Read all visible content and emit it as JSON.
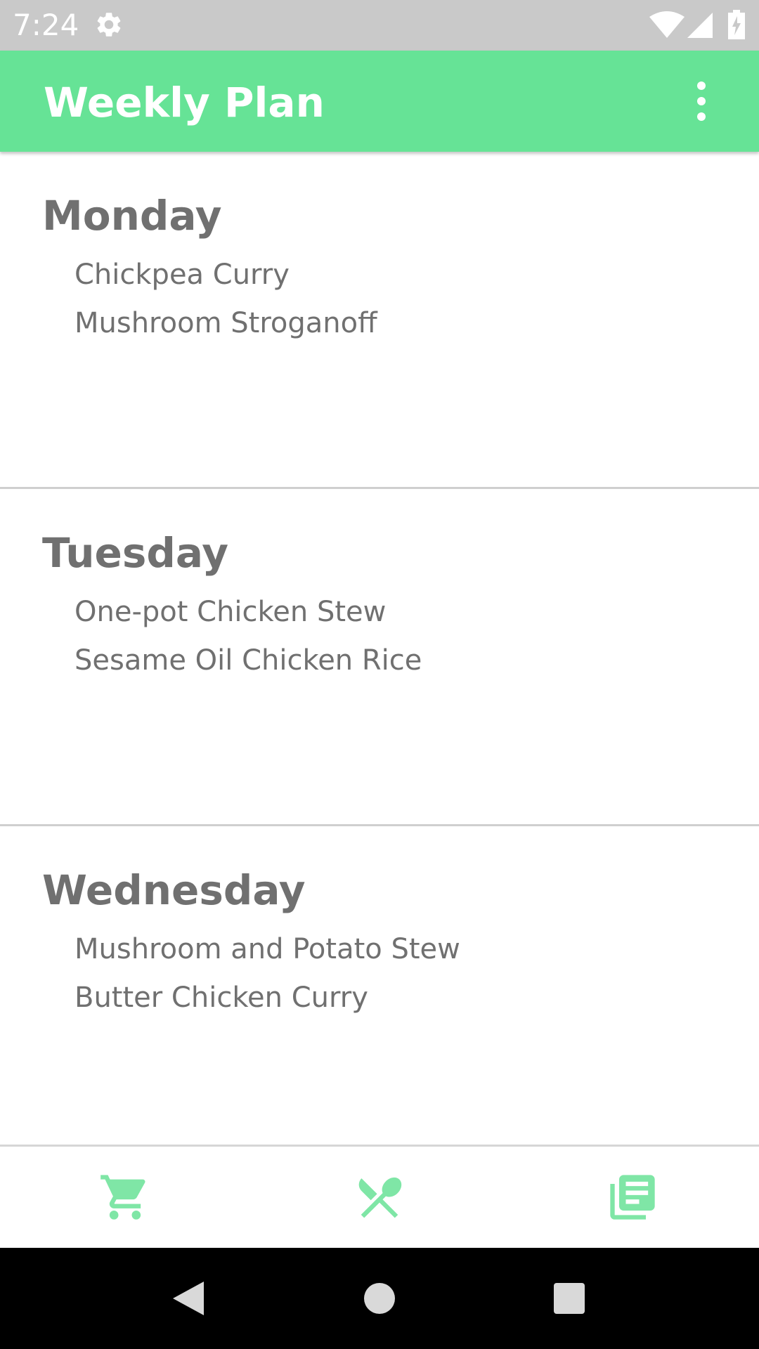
{
  "status_bar": {
    "time": "7:24",
    "icons": [
      "settings-gear-icon",
      "wifi-icon",
      "cell-signal-icon",
      "battery-charging-icon"
    ]
  },
  "app_bar": {
    "title": "Weekly Plan",
    "menu_icon": "more-vert-icon"
  },
  "days": [
    {
      "name": "Monday",
      "meals": [
        "Chickpea Curry",
        "Mushroom Stroganoff"
      ]
    },
    {
      "name": "Tuesday",
      "meals": [
        "One-pot Chicken Stew",
        "Sesame Oil Chicken Rice"
      ]
    },
    {
      "name": "Wednesday",
      "meals": [
        "Mushroom and Potato Stew",
        "Butter Chicken Curry"
      ]
    }
  ],
  "bottom_nav": {
    "items": [
      {
        "icon": "shopping-cart-icon"
      },
      {
        "icon": "restaurant-icon"
      },
      {
        "icon": "recipe-list-icon"
      }
    ]
  },
  "system_nav": {
    "items": [
      "back-icon",
      "home-icon",
      "recents-icon"
    ]
  },
  "colors": {
    "accent": "#66e396",
    "status_bar": "#c9c9c9",
    "text_gray": "#707070",
    "divider": "#cfcfcf",
    "icon_green": "#7fe6a6"
  }
}
